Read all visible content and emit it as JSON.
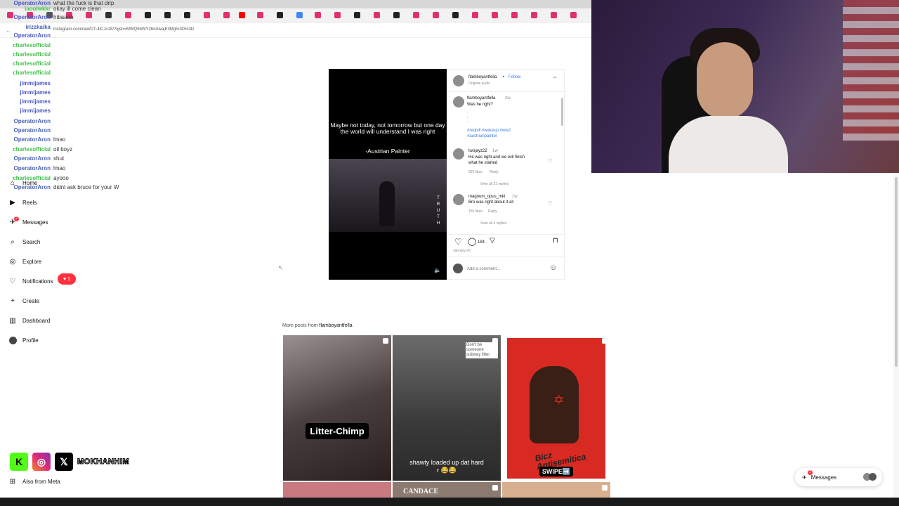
{
  "browser": {
    "url": "instagram.com/reel/DT-4iCJo18/?igsh=MWQ5bWY2bnAwajE3Mg%3D%3D"
  },
  "chat": {
    "rows": [
      {
        "user": "OperatorAron",
        "msg": "what the fuck is that drip",
        "color": "#4a58c9"
      },
      {
        "user": "iaoolwkkr",
        "msg": "okay ill come clean",
        "color": "#41c14a"
      },
      {
        "user": "OperatorAron",
        "msg": "hibaaaa",
        "color": "#4a58c9"
      },
      {
        "user": "irizzkaika",
        "msg": "",
        "color": "#4963b8"
      },
      {
        "user": "OperatorAron",
        "msg": "",
        "color": "#4a58c9"
      },
      {
        "user": "charlesofficial",
        "msg": "",
        "color": "#41c14a"
      },
      {
        "user": "charlesofficial",
        "msg": "",
        "color": "#41c14a"
      },
      {
        "user": "charlesofficial",
        "msg": "",
        "color": "#41c14a"
      },
      {
        "user": "charlesofficial",
        "msg": "",
        "color": "#41c14a"
      },
      {
        "user": "jimmijames",
        "msg": "",
        "color": "#4a58c9"
      },
      {
        "user": "jimmijames",
        "msg": "",
        "color": "#4a58c9"
      },
      {
        "user": "jimmijames",
        "msg": "",
        "color": "#4a58c9"
      },
      {
        "user": "jimmijames",
        "msg": "",
        "color": "#4a58c9"
      },
      {
        "user": "OperatorAron",
        "msg": "",
        "color": "#4963b8"
      },
      {
        "user": "OperatorAron",
        "msg": "",
        "color": "#4963b8"
      },
      {
        "user": "OperatorAron",
        "msg": "lmao",
        "color": "#4963b8"
      },
      {
        "user": "charlesofficial",
        "msg": "oil boyz",
        "color": "#41c14a"
      },
      {
        "user": "OperatorAron",
        "msg": "shut",
        "color": "#4963b8"
      },
      {
        "user": "OperatorAron",
        "msg": "lmao",
        "color": "#4963b8"
      },
      {
        "user": "charlesofficial",
        "msg": "ayooo",
        "color": "#41c14a"
      },
      {
        "user": "OperatorAron",
        "msg": "didnt ask bruce for your W",
        "color": "#4963b8"
      }
    ]
  },
  "sidebar": {
    "items": [
      {
        "label": "Home",
        "icon": "home-icon"
      },
      {
        "label": "Reels",
        "icon": "reels-icon"
      },
      {
        "label": "Messages",
        "icon": "messages-icon"
      },
      {
        "label": "Search",
        "icon": "search-icon"
      },
      {
        "label": "Explore",
        "icon": "explore-icon"
      },
      {
        "label": "Notifications",
        "icon": "heart-icon"
      },
      {
        "label": "Create",
        "icon": "plus-icon"
      },
      {
        "label": "Dashboard",
        "icon": "dashboard-icon"
      },
      {
        "label": "Profile",
        "icon": "avatar-icon"
      }
    ],
    "notification_count": "1",
    "messages_badge": "2",
    "also_from_meta": "Also from Meta"
  },
  "post": {
    "media": {
      "quote": "Maybe not today, not tomorrow but one day the world will understand I was right",
      "credit": "-Austrian Painter",
      "vertical_text": [
        "T",
        "R",
        "U",
        "T",
        "H"
      ]
    },
    "header": {
      "username": "flamboyantfella",
      "separator": "•",
      "follow": "Follow",
      "audio": "Original audio",
      "more": "···"
    },
    "caption": {
      "username": "flamboyantfella",
      "time": "2w",
      "text": "Was he right?",
      "dots": [
        ".",
        ".",
        "."
      ],
      "hashtags_line1": "#redpill #wakeup #ww2",
      "hashtags_line2": "#austrianpainter"
    },
    "comments": [
      {
        "username": "twojayz22",
        "time": "1w",
        "text_line1": "He was right and we will finish",
        "text_line2": "what he started",
        "likes": "692 likes",
        "reply": "Reply",
        "view_replies": "View all 21 replies"
      },
      {
        "username": "magnum_opus_mki",
        "time": "1w",
        "text_line1": "Bro was right about it all",
        "text_line2": "",
        "likes": "155 likes",
        "reply": "Reply",
        "view_replies": "View all 4 replies"
      }
    ],
    "comment_count": "194",
    "date": "January 26",
    "add_comment_placeholder": "Add a comment..."
  },
  "more_posts": {
    "label_prefix": "More posts from ",
    "label_user": "flamboyantfella",
    "tiles": [
      {
        "caption": "Litter-Chimp"
      },
      {
        "caption": "shawty loaded up dat hard r 😂😂",
        "overlay": "Don't be someone subway litter"
      },
      {
        "caption": "SWIPE➡️",
        "poster_text": "Bicz Antisemitica"
      },
      {
        "caption": ""
      },
      {
        "caption": "CANDACE"
      },
      {
        "caption": ""
      }
    ]
  },
  "socials": {
    "handle": "MOKHANHIM"
  },
  "messages_pill": {
    "label": "Messages",
    "badge": "2"
  }
}
